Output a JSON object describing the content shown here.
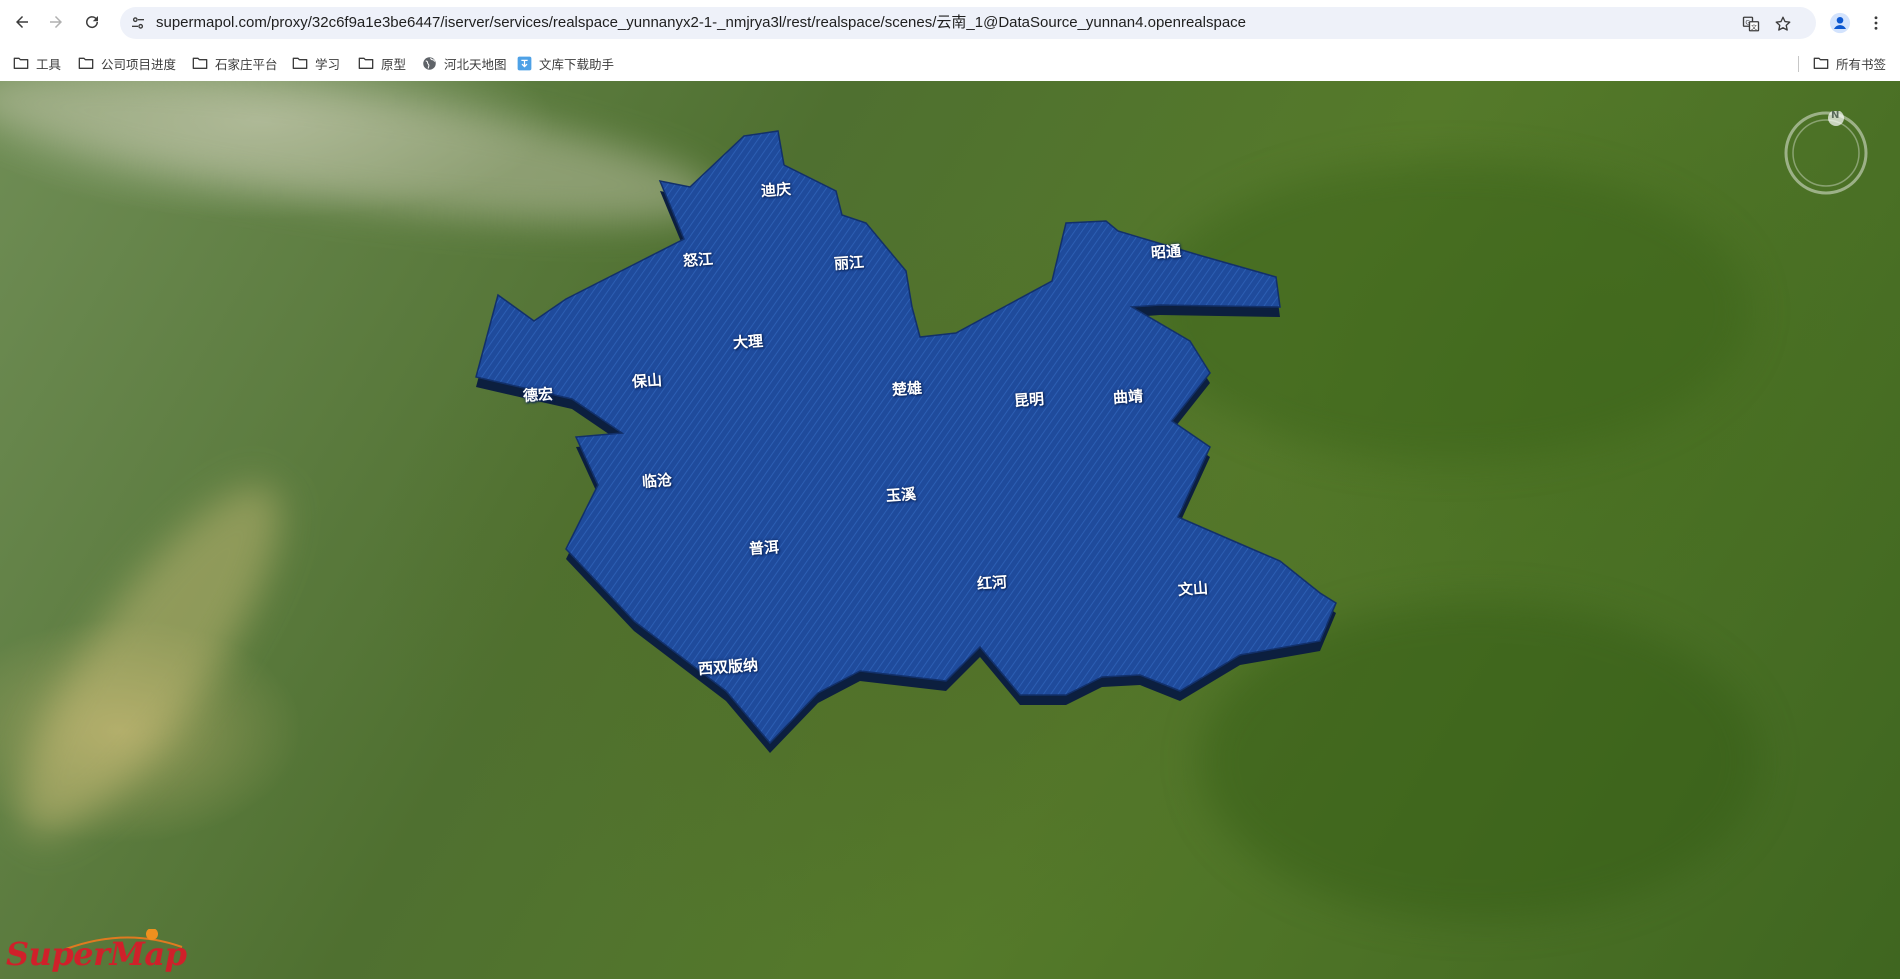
{
  "browser": {
    "url": "supermapol.com/proxy/32c6f9a1e3be6447/iserver/services/realspace_yunnanyx2-1-_nmjrya3l/rest/realspace/scenes/云南_1@DataSource_yunnan4.openrealspace",
    "icons": {
      "back": "arrow-left-icon",
      "forward": "arrow-right-icon",
      "reload": "reload-icon",
      "site_info": "tune-icon",
      "translate": "translate-icon",
      "bookmark": "star-icon",
      "profile": "person-icon",
      "menu": "more-vertical-icon"
    }
  },
  "bookmarks": {
    "items": [
      {
        "label": "工具",
        "icon": "folder-icon"
      },
      {
        "label": "公司项目进度",
        "icon": "folder-icon"
      },
      {
        "label": "石家庄平台",
        "icon": "folder-icon"
      },
      {
        "label": "学习",
        "icon": "folder-icon"
      },
      {
        "label": "原型",
        "icon": "folder-icon"
      },
      {
        "label": "河北天地图",
        "icon": "globe-icon"
      },
      {
        "label": "文库下载助手",
        "icon": "app-icon"
      }
    ],
    "all_bookmarks": "所有书签"
  },
  "map": {
    "province_color": "#1e4a9a",
    "cities": [
      {
        "name": "迪庆"
      },
      {
        "name": "怒江"
      },
      {
        "name": "丽江"
      },
      {
        "name": "昭通"
      },
      {
        "name": "大理"
      },
      {
        "name": "保山"
      },
      {
        "name": "德宏"
      },
      {
        "name": "楚雄"
      },
      {
        "name": "昆明"
      },
      {
        "name": "曲靖"
      },
      {
        "name": "临沧"
      },
      {
        "name": "玉溪"
      },
      {
        "name": "普洱"
      },
      {
        "name": "红河"
      },
      {
        "name": "文山"
      },
      {
        "name": "西双版纳"
      }
    ],
    "compass_label": "N",
    "logo": "SuperMap"
  }
}
